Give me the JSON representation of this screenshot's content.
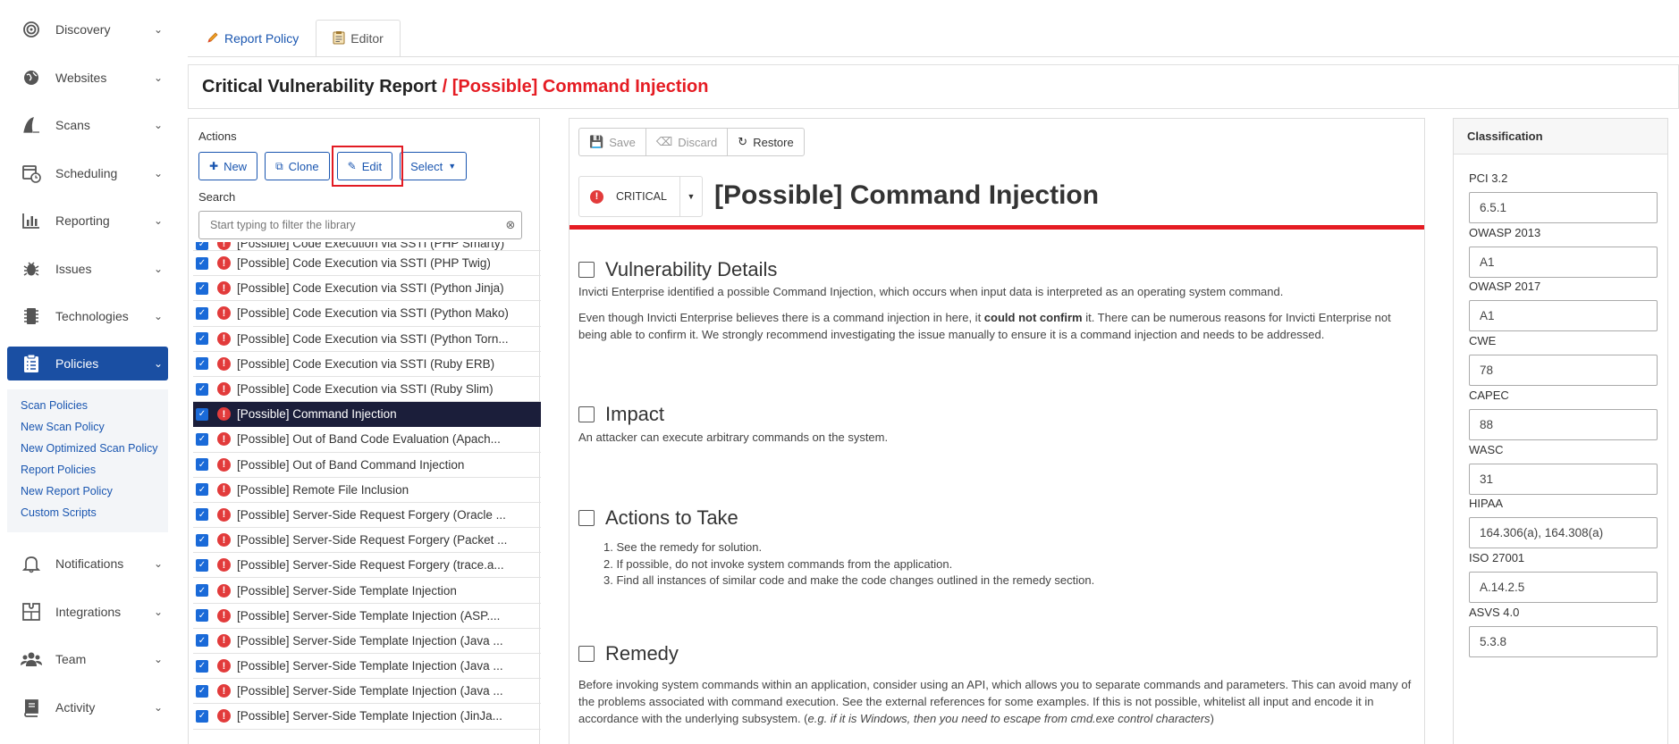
{
  "sidebar": {
    "items": [
      {
        "label": "Discovery",
        "icon": "target-icon"
      },
      {
        "label": "Websites",
        "icon": "globe-icon"
      },
      {
        "label": "Scans",
        "icon": "shark-icon"
      },
      {
        "label": "Scheduling",
        "icon": "calendar-clock-icon"
      },
      {
        "label": "Reporting",
        "icon": "bar-chart-icon"
      },
      {
        "label": "Issues",
        "icon": "bug-icon"
      },
      {
        "label": "Technologies",
        "icon": "chip-icon"
      },
      {
        "label": "Policies",
        "icon": "clipboard-list-icon"
      },
      {
        "label": "Notifications",
        "icon": "bell-icon"
      },
      {
        "label": "Integrations",
        "icon": "puzzle-icon"
      },
      {
        "label": "Team",
        "icon": "users-icon"
      },
      {
        "label": "Activity",
        "icon": "book-icon"
      }
    ],
    "subnav": [
      "Scan Policies",
      "New Scan Policy",
      "New Optimized Scan Policy",
      "Report Policies",
      "New Report Policy",
      "Custom Scripts"
    ]
  },
  "tabs": [
    {
      "label": "Report Policy",
      "icon": "pencil-icon"
    },
    {
      "label": "Editor",
      "icon": "clipboard-icon"
    }
  ],
  "header": {
    "title": "Critical Vulnerability Report",
    "subtitle": "/ [Possible] Command Injection"
  },
  "library": {
    "actions_label": "Actions",
    "buttons": {
      "new": "New",
      "clone": "Clone",
      "edit": "Edit",
      "select": "Select"
    },
    "search_label": "Search",
    "search_placeholder": "Start typing to filter the library",
    "partial_item": "[Possible] Code Execution via SSTI (PHP Smarty)",
    "items": [
      "[Possible] Code Execution via SSTI (PHP Twig)",
      "[Possible] Code Execution via SSTI (Python Jinja)",
      "[Possible] Code Execution via SSTI (Python Mako)",
      "[Possible] Code Execution via SSTI (Python Torn...",
      "[Possible] Code Execution via SSTI (Ruby ERB)",
      "[Possible] Code Execution via SSTI (Ruby Slim)",
      "[Possible] Command Injection",
      "[Possible] Out of Band Code Evaluation (Apach...",
      "[Possible] Out of Band Command Injection",
      "[Possible] Remote File Inclusion",
      "[Possible] Server-Side Request Forgery (Oracle ...",
      "[Possible] Server-Side Request Forgery (Packet ...",
      "[Possible] Server-Side Request Forgery (trace.a...",
      "[Possible] Server-Side Template Injection",
      "[Possible] Server-Side Template Injection (ASP....",
      "[Possible] Server-Side Template Injection (Java ...",
      "[Possible] Server-Side Template Injection (Java ...",
      "[Possible] Server-Side Template Injection (Java ...",
      "[Possible] Server-Side Template Injection (JinJa..."
    ],
    "selected_index": 6
  },
  "editor": {
    "toolbar": {
      "save": "Save",
      "discard": "Discard",
      "restore": "Restore"
    },
    "severity": "CRITICAL",
    "title": "[Possible] Command Injection",
    "sections": {
      "details": {
        "heading": "Vulnerability Details",
        "p1": "Invicti Enterprise identified a possible Command Injection, which occurs when input data is interpreted as an operating system command.",
        "p2_a": "Even though Invicti Enterprise believes there is a command injection in here, it ",
        "p2_b": "could not confirm",
        "p2_c": " it. There can be numerous reasons for Invicti Enterprise not being able to confirm it. We strongly recommend investigating the issue manually to ensure it is a command injection and needs to be addressed."
      },
      "impact": {
        "heading": "Impact",
        "p1": "An attacker can execute arbitrary commands on the system."
      },
      "actions": {
        "heading": "Actions to Take",
        "steps": [
          "See the remedy for solution.",
          "If possible, do not invoke system commands from the application.",
          "Find all instances of similar code and make the code changes outlined in the remedy section."
        ]
      },
      "remedy": {
        "heading": "Remedy",
        "p1_a": "Before invoking system commands within an application, consider using an API, which allows you to separate commands and parameters. This can avoid many of the problems associated with command execution. See the external references for some examples. If this is not possible, whitelist all input and encode it in accordance with the underlying subsystem. (",
        "p1_b": "e.g. if it is Windows, then you need to escape from cmd.exe control characters",
        "p1_c": ")"
      }
    }
  },
  "classification": {
    "title": "Classification",
    "fields": [
      {
        "label": "PCI 3.2",
        "value": "6.5.1"
      },
      {
        "label": "OWASP 2013",
        "value": "A1"
      },
      {
        "label": "OWASP 2017",
        "value": "A1"
      },
      {
        "label": "CWE",
        "value": "78"
      },
      {
        "label": "CAPEC",
        "value": "88"
      },
      {
        "label": "WASC",
        "value": "31"
      },
      {
        "label": "HIPAA",
        "value": "164.306(a), 164.308(a)"
      },
      {
        "label": "ISO 27001",
        "value": "A.14.2.5"
      },
      {
        "label": "ASVS 4.0",
        "value": "5.3.8"
      }
    ]
  },
  "colors": {
    "primary": "#1a4fa3",
    "link": "#1a56b0",
    "critical": "#e51c23",
    "selected_row": "#1b1e3a"
  }
}
